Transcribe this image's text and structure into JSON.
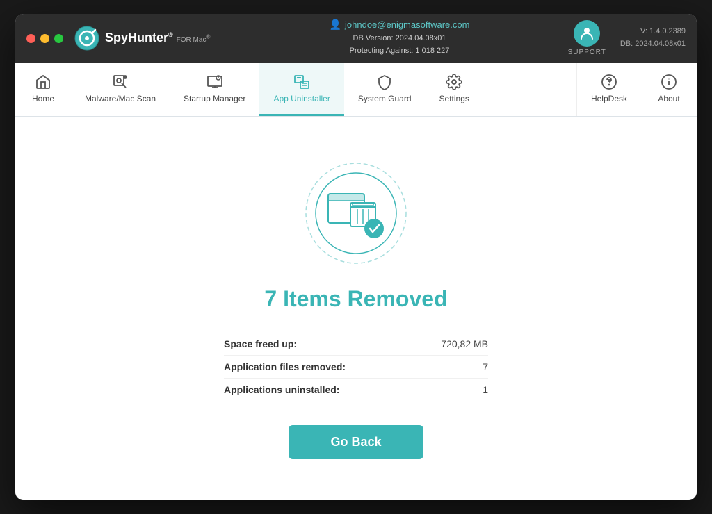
{
  "window": {
    "title": "SpyHunter for Mac"
  },
  "titlebar": {
    "logo_main": "SpyHunter",
    "logo_for": "FOR",
    "logo_mac": "Mac",
    "user_email": "johndoe@enigmasoftware.com",
    "db_version_label": "DB Version:",
    "db_version": "2024.04.08x01",
    "protecting_label": "Protecting Against:",
    "protecting_count": "1 018 227",
    "support_label": "SUPPORT",
    "version_label": "V: 1.4.0.2389",
    "db_label": "DB:  2024.04.08x01"
  },
  "navbar": {
    "items": [
      {
        "id": "home",
        "label": "Home",
        "active": false
      },
      {
        "id": "malware-scan",
        "label": "Malware/Mac Scan",
        "active": false
      },
      {
        "id": "startup-manager",
        "label": "Startup Manager",
        "active": false
      },
      {
        "id": "app-uninstaller",
        "label": "App Uninstaller",
        "active": true
      },
      {
        "id": "system-guard",
        "label": "System Guard",
        "active": false
      },
      {
        "id": "settings",
        "label": "Settings",
        "active": false
      }
    ],
    "right_items": [
      {
        "id": "helpdesk",
        "label": "HelpDesk"
      },
      {
        "id": "about",
        "label": "About"
      }
    ]
  },
  "main": {
    "result_title": "7 Items Removed",
    "stats": [
      {
        "label": "Space freed up:",
        "value": "720,82 MB"
      },
      {
        "label": "Application files removed:",
        "value": "7"
      },
      {
        "label": "Applications uninstalled:",
        "value": "1"
      }
    ],
    "go_back_label": "Go Back"
  },
  "colors": {
    "accent": "#3ab5b5",
    "active_nav": "#3ab5b5"
  }
}
